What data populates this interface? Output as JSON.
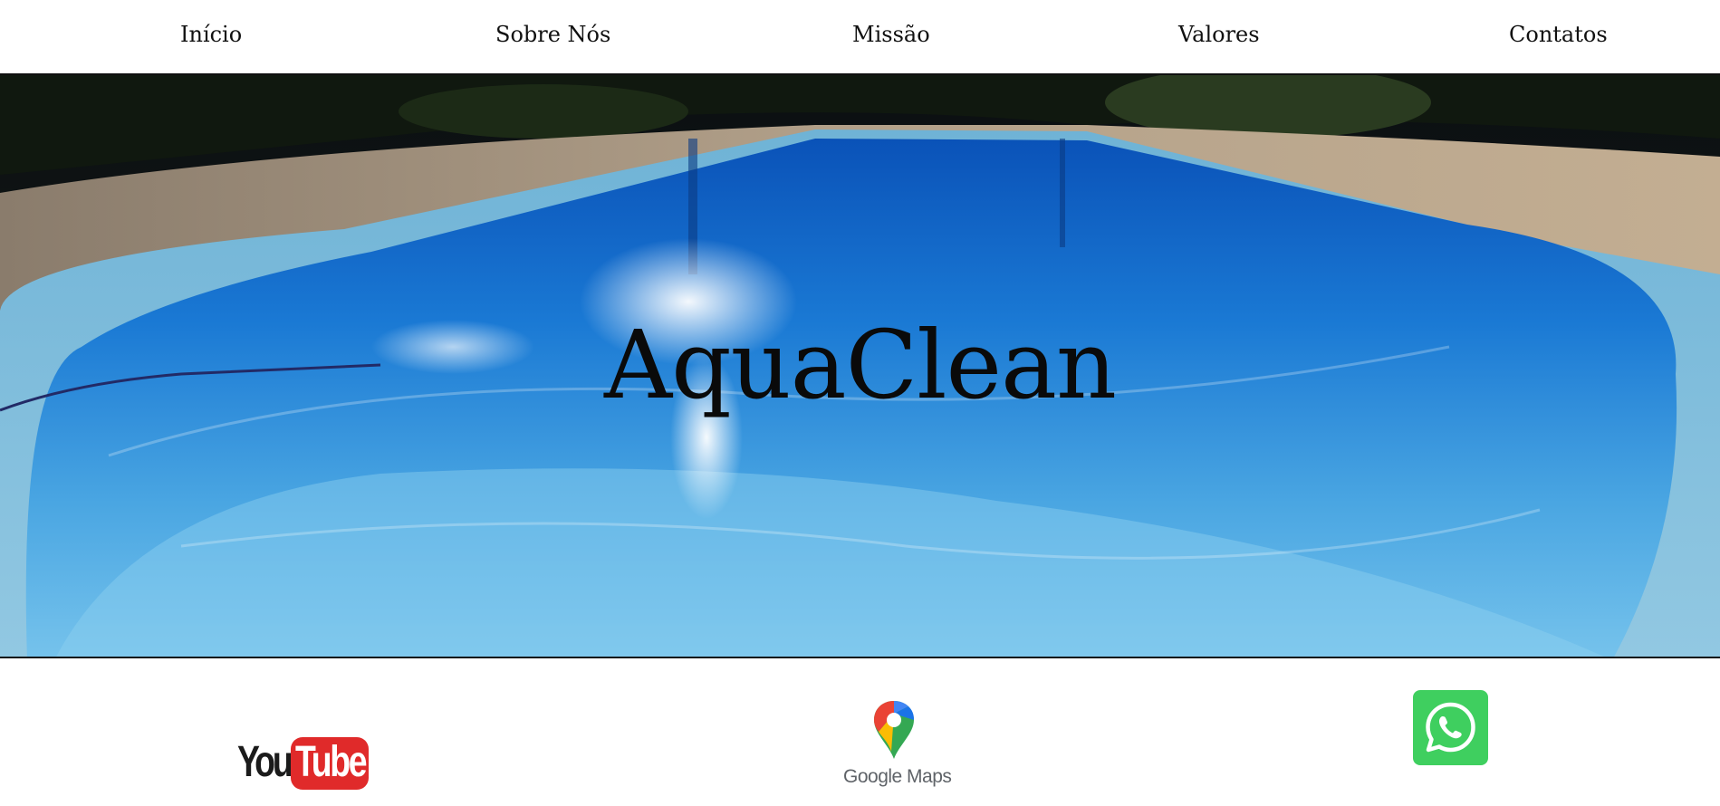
{
  "nav": {
    "items": [
      {
        "label": "Início"
      },
      {
        "label": "Sobre Nós"
      },
      {
        "label": "Missão"
      },
      {
        "label": "Valores"
      },
      {
        "label": "Contatos"
      }
    ]
  },
  "hero": {
    "title": "AquaClean",
    "image": "swimming-pool-photo"
  },
  "footer": {
    "youtube": {
      "icon": "youtube-icon",
      "you": "You",
      "tube": "Tube",
      "color": "#e02a2a"
    },
    "google_maps": {
      "icon": "google-maps-icon",
      "text": "Google Maps"
    },
    "whatsapp": {
      "icon": "whatsapp-icon",
      "color": "#3fcf5f"
    }
  }
}
